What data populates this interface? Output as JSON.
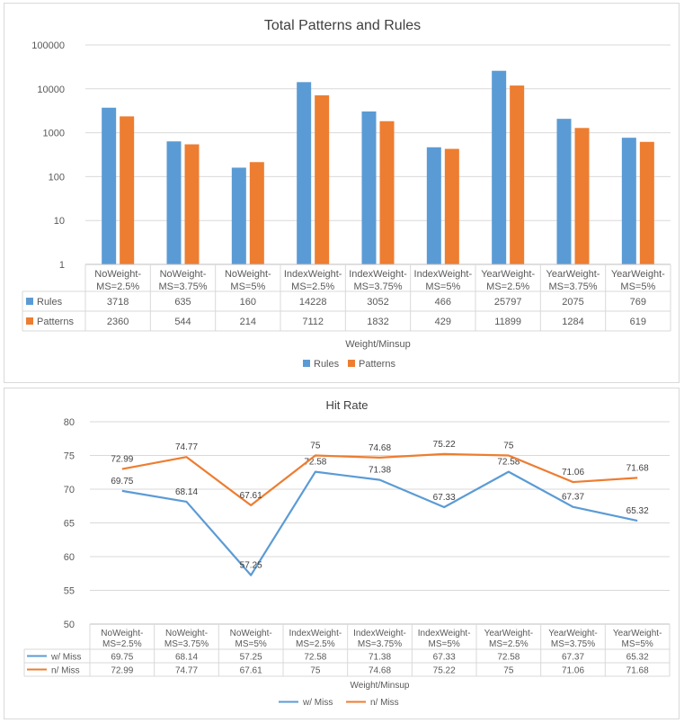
{
  "chart_data": [
    {
      "type": "bar",
      "title": "Total Patterns and Rules",
      "xlabel": "Weight/Minsup",
      "ylabel": "",
      "yscale": "log",
      "ylim": [
        1,
        100000
      ],
      "yticks": [
        "1",
        "10",
        "100",
        "1000",
        "10000",
        "100000"
      ],
      "grid": true,
      "legend_position": "bottom",
      "categories": [
        [
          "NoWeight-",
          "MS=2.5%"
        ],
        [
          "NoWeight-",
          "MS=3.75%"
        ],
        [
          "NoWeight-",
          "MS=5%"
        ],
        [
          "IndexWeight-",
          "MS=2.5%"
        ],
        [
          "IndexWeight-",
          "MS=3.75%"
        ],
        [
          "IndexWeight-",
          "MS=5%"
        ],
        [
          "YearWeight-",
          "MS=2.5%"
        ],
        [
          "YearWeight-",
          "MS=3.75%"
        ],
        [
          "YearWeight-",
          "MS=5%"
        ]
      ],
      "series": [
        {
          "name": "Rules",
          "color": "#5B9BD5",
          "values": [
            3718,
            635,
            160,
            14228,
            3052,
            466,
            25797,
            2075,
            769
          ]
        },
        {
          "name": "Patterns",
          "color": "#ED7D31",
          "values": [
            2360,
            544,
            214,
            7112,
            1832,
            429,
            11899,
            1284,
            619
          ]
        }
      ]
    },
    {
      "type": "line",
      "title": "Hit Rate",
      "xlabel": "Weight/Minsup",
      "ylabel": "",
      "ylim": [
        50,
        80
      ],
      "yticks": [
        "50",
        "55",
        "60",
        "65",
        "70",
        "75",
        "80"
      ],
      "grid": true,
      "legend_position": "bottom",
      "categories": [
        [
          "NoWeight-",
          "MS=2.5%"
        ],
        [
          "NoWeight-",
          "MS=3.75%"
        ],
        [
          "NoWeight-",
          "MS=5%"
        ],
        [
          "IndexWeight-",
          "MS=2.5%"
        ],
        [
          "IndexWeight-",
          "MS=3.75%"
        ],
        [
          "IndexWeight-",
          "MS=5%"
        ],
        [
          "YearWeight-",
          "MS=2.5%"
        ],
        [
          "YearWeight-",
          "MS=3.75%"
        ],
        [
          "YearWeight-",
          "MS=5%"
        ]
      ],
      "series": [
        {
          "name": "w/ Miss",
          "color": "#5B9BD5",
          "values": [
            69.75,
            68.14,
            57.25,
            72.58,
            71.38,
            67.33,
            72.58,
            67.37,
            65.32
          ]
        },
        {
          "name": "n/ Miss",
          "color": "#ED7D31",
          "values": [
            72.99,
            74.77,
            67.61,
            75,
            74.68,
            75.22,
            75,
            71.06,
            71.68
          ]
        }
      ]
    }
  ]
}
